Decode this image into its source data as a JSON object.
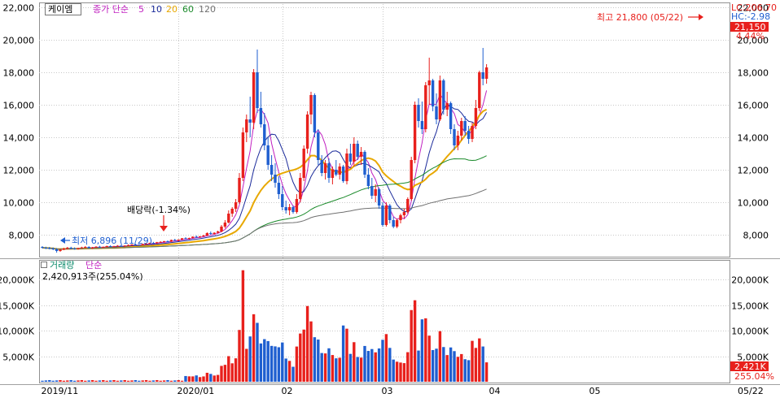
{
  "stock": {
    "name": "케이엠",
    "ma_label": "종가 단순",
    "ma_periods": [
      "5",
      "10",
      "20",
      "60",
      "120"
    ],
    "ma_colors": [
      "#c020c0",
      "#1a2a9a",
      "#e8a800",
      "#1a8a2a",
      "#707070"
    ]
  },
  "right_info": {
    "lc": "LC:206.70",
    "hc": "HC:-2.98",
    "price_box": "21,150",
    "change_pct": "4.44%",
    "volume_box": "2,421K",
    "volume_pct": "255.04%"
  },
  "annotations": {
    "high": "최고 21,800 (05/22)",
    "low": "최저 6,896 (11/29)",
    "dividend": "배당락(-1.34%)"
  },
  "volume_panel": {
    "title": "거래량",
    "subtitle": "단순",
    "value": "2,420,913주(255.04%)"
  },
  "colors": {
    "up": "#e8201c",
    "down": "#1f5fd0",
    "grid": "#c8c8c8",
    "label_box": "#e8201c"
  },
  "chart_data": {
    "type": "candlestick",
    "price_axis": {
      "ylim": [
        6700,
        22200
      ],
      "ticks": [
        8000,
        10000,
        12000,
        14000,
        16000,
        18000,
        20000,
        22000
      ],
      "tick_labels": [
        "8,000",
        "10,000",
        "12,000",
        "14,000",
        "16,000",
        "18,000",
        "20,000",
        "22,000"
      ]
    },
    "volume_axis": {
      "ylim": [
        0,
        23500
      ],
      "ticks": [
        5000,
        10000,
        15000,
        20000
      ],
      "tick_labels": [
        "5,000K",
        "10,000K",
        "15,000K",
        "20,000K"
      ]
    },
    "x_labels": [
      {
        "idx": 0,
        "label": "2019/11"
      },
      {
        "idx": 38,
        "label": "2020/01"
      },
      {
        "idx": 67,
        "label": "02"
      },
      {
        "idx": 95,
        "label": "03"
      },
      {
        "idx": 125,
        "label": "04"
      },
      {
        "idx": 153,
        "label": "05"
      },
      {
        "idx": 178,
        "label": "05/22"
      }
    ],
    "candles": [
      [
        7250,
        7300,
        7150,
        7200
      ],
      [
        7200,
        7260,
        7120,
        7180
      ],
      [
        7180,
        7250,
        7100,
        7150
      ],
      [
        7150,
        7220,
        7050,
        7100
      ],
      [
        7100,
        7180,
        6896,
        7000
      ],
      [
        7000,
        7120,
        6950,
        7080
      ],
      [
        7080,
        7200,
        7050,
        7150
      ],
      [
        7150,
        7250,
        7100,
        7200
      ],
      [
        7200,
        7260,
        7120,
        7150
      ],
      [
        7150,
        7220,
        7080,
        7120
      ],
      [
        7120,
        7200,
        7080,
        7180
      ],
      [
        7180,
        7260,
        7150,
        7220
      ],
      [
        7220,
        7300,
        7180,
        7250
      ],
      [
        7250,
        7290,
        7150,
        7180
      ],
      [
        7180,
        7250,
        7120,
        7220
      ],
      [
        7220,
        7300,
        7200,
        7260
      ],
      [
        7260,
        7320,
        7200,
        7230
      ],
      [
        7230,
        7280,
        7180,
        7250
      ],
      [
        7250,
        7330,
        7220,
        7300
      ],
      [
        7300,
        7350,
        7240,
        7270
      ],
      [
        7270,
        7320,
        7220,
        7290
      ],
      [
        7290,
        7360,
        7260,
        7320
      ],
      [
        7320,
        7380,
        7280,
        7300
      ],
      [
        7300,
        7350,
        7250,
        7330
      ],
      [
        7330,
        7400,
        7300,
        7370
      ],
      [
        7370,
        7420,
        7330,
        7400
      ],
      [
        7400,
        7450,
        7350,
        7380
      ],
      [
        7380,
        7420,
        7320,
        7360
      ],
      [
        7360,
        7450,
        7340,
        7430
      ],
      [
        7430,
        7480,
        7380,
        7450
      ],
      [
        7450,
        7520,
        7420,
        7500
      ],
      [
        7500,
        7560,
        7450,
        7480
      ],
      [
        7480,
        7560,
        7460,
        7540
      ],
      [
        7540,
        7600,
        7500,
        7560
      ],
      [
        7560,
        7620,
        7520,
        7600
      ],
      [
        7600,
        7650,
        7540,
        7580
      ],
      [
        7580,
        7700,
        7560,
        7680
      ],
      [
        7680,
        7750,
        7620,
        7650
      ],
      [
        7650,
        7720,
        7600,
        7700
      ],
      [
        7700,
        7800,
        7680,
        7780
      ],
      [
        7780,
        7850,
        7720,
        7750
      ],
      [
        7750,
        7820,
        7700,
        7800
      ],
      [
        7800,
        7900,
        7780,
        7880
      ],
      [
        7880,
        7950,
        7800,
        7850
      ],
      [
        7850,
        7920,
        7820,
        7900
      ],
      [
        7900,
        8000,
        7880,
        7950
      ],
      [
        7950,
        8150,
        7920,
        8100
      ],
      [
        8100,
        8200,
        8000,
        8050
      ],
      [
        8050,
        8150,
        8000,
        8120
      ],
      [
        8120,
        8250,
        8080,
        8200
      ],
      [
        8200,
        8600,
        8150,
        8500
      ],
      [
        8500,
        8900,
        8400,
        8750
      ],
      [
        8750,
        9500,
        8700,
        9300
      ],
      [
        9300,
        9700,
        9100,
        9600
      ],
      [
        9600,
        10200,
        9400,
        10000
      ],
      [
        10000,
        11800,
        9900,
        11500
      ],
      [
        11500,
        14600,
        11300,
        14300
      ],
      [
        14300,
        15400,
        13700,
        15100
      ],
      [
        15100,
        16500,
        14000,
        14900
      ],
      [
        14900,
        18200,
        14500,
        18000
      ],
      [
        18000,
        19400,
        15500,
        15800
      ],
      [
        15800,
        16800,
        14600,
        14800
      ],
      [
        14800,
        15500,
        13200,
        13500
      ],
      [
        13500,
        14000,
        12000,
        12300
      ],
      [
        12300,
        12900,
        11300,
        11700
      ],
      [
        11700,
        12400,
        10900,
        11200
      ],
      [
        11200,
        11600,
        10200,
        10500
      ],
      [
        10500,
        11000,
        9500,
        9700
      ],
      [
        9700,
        10100,
        9300,
        9500
      ],
      [
        9500,
        9900,
        9200,
        9700
      ],
      [
        9700,
        9800,
        9300,
        9400
      ],
      [
        9400,
        10500,
        9300,
        10200
      ],
      [
        10200,
        11800,
        10000,
        11500
      ],
      [
        11500,
        13500,
        11300,
        13300
      ],
      [
        13300,
        15600,
        13000,
        15400
      ],
      [
        15400,
        16800,
        14800,
        16600
      ],
      [
        16600,
        16700,
        14000,
        14300
      ],
      [
        14300,
        14500,
        12300,
        12600
      ],
      [
        12600,
        12900,
        11600,
        11800
      ],
      [
        11800,
        12600,
        11400,
        12400
      ],
      [
        12400,
        12700,
        11200,
        11500
      ],
      [
        11500,
        12200,
        11100,
        12000
      ],
      [
        12000,
        12600,
        11600,
        11700
      ],
      [
        11700,
        12400,
        11400,
        12200
      ],
      [
        12200,
        12300,
        11200,
        11300
      ],
      [
        11300,
        13300,
        11100,
        13000
      ],
      [
        13000,
        13600,
        12300,
        12500
      ],
      [
        12500,
        14000,
        12200,
        13600
      ],
      [
        13600,
        13800,
        12600,
        12800
      ],
      [
        12800,
        13400,
        12300,
        13100
      ],
      [
        13100,
        13200,
        11500,
        11700
      ],
      [
        11700,
        12100,
        10800,
        11000
      ],
      [
        11000,
        11500,
        10200,
        10400
      ],
      [
        10400,
        11100,
        10000,
        10800
      ],
      [
        10800,
        10900,
        9600,
        9800
      ],
      [
        9800,
        10000,
        8500,
        8600
      ],
      [
        8600,
        10000,
        8500,
        9800
      ],
      [
        9800,
        9900,
        8700,
        8900
      ],
      [
        8900,
        9100,
        8400,
        8500
      ],
      [
        8500,
        9000,
        8400,
        8900
      ],
      [
        8900,
        9300,
        8700,
        9200
      ],
      [
        9200,
        9600,
        9000,
        9400
      ],
      [
        9400,
        10300,
        9300,
        10200
      ],
      [
        10200,
        12800,
        10100,
        12600
      ],
      [
        12600,
        16200,
        12400,
        16000
      ],
      [
        16000,
        16400,
        14600,
        15000
      ],
      [
        15000,
        16200,
        14200,
        14500
      ],
      [
        14500,
        17400,
        14300,
        17200
      ],
      [
        17200,
        18900,
        16000,
        17500
      ],
      [
        17500,
        17600,
        15600,
        15900
      ],
      [
        15900,
        16700,
        14800,
        15100
      ],
      [
        15100,
        17800,
        15000,
        17500
      ],
      [
        17500,
        17600,
        15400,
        15700
      ],
      [
        15700,
        16800,
        15300,
        16100
      ],
      [
        16100,
        16200,
        14200,
        14500
      ],
      [
        14500,
        14800,
        13200,
        13500
      ],
      [
        13500,
        14400,
        13200,
        14100
      ],
      [
        14100,
        15200,
        13800,
        15000
      ],
      [
        15000,
        15300,
        14100,
        14400
      ],
      [
        14400,
        14700,
        13600,
        13900
      ],
      [
        13900,
        14900,
        13700,
        14700
      ],
      [
        14700,
        16300,
        14500,
        15800
      ],
      [
        15800,
        18100,
        15600,
        18000
      ],
      [
        18000,
        19500,
        17200,
        17600
      ],
      [
        17600,
        18500,
        17300,
        18300
      ]
    ],
    "ma": {
      "5": [
        7200,
        7180,
        7170,
        7150,
        7140,
        7120,
        7110,
        7120,
        7150,
        7170,
        7170,
        7180,
        7200,
        7210,
        7230,
        7240,
        7250,
        7260,
        7270,
        7280,
        7290,
        7300,
        7310,
        7320,
        7330,
        7360,
        7370,
        7380,
        7390,
        7410,
        7420,
        7440,
        7460,
        7480,
        7510,
        7540,
        7570,
        7600,
        7630,
        7660,
        7690,
        7720,
        7750,
        7790,
        7820,
        7850,
        7880,
        7920,
        7960,
        8010,
        8060,
        8140,
        8320,
        8530,
        8800,
        9200,
        10200,
        11400,
        12500,
        13600,
        14800,
        15600,
        16000,
        15400,
        14600,
        13600,
        12700,
        11800,
        11000,
        10300,
        9900,
        9600,
        9600,
        9800,
        10400,
        11300,
        12200,
        12900,
        13400,
        13600,
        13700,
        13600,
        13100,
        12500,
        12000,
        11700,
        11600,
        11900,
        12200,
        12400,
        12600,
        12400,
        12000,
        11600,
        11200,
        10800,
        10300,
        9900,
        9400,
        9000,
        8800,
        8800,
        8800,
        9000,
        9200,
        9800,
        10700,
        11800,
        13000,
        14100,
        15200,
        15700,
        15800,
        16100,
        16300,
        16200,
        15900,
        15500,
        14900,
        14500,
        14200,
        14100,
        14100,
        14300,
        14600,
        15300,
        16200,
        16900
      ]
    },
    "vol_sample_note": ""
  }
}
